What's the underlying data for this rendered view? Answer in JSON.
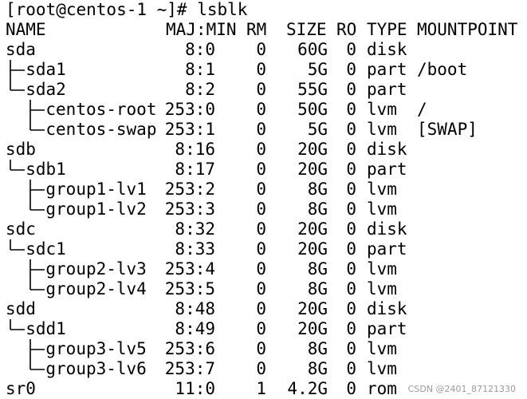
{
  "prompt": "[root@centos-1 ~]# lsblk",
  "headers": {
    "name": "NAME",
    "majmin": "MAJ:MIN",
    "rm": "RM",
    "size": "SIZE",
    "ro": "RO",
    "type": "TYPE",
    "mountpoint": "MOUNTPOINT"
  },
  "rows": [
    {
      "name": "sda",
      "depth": 0,
      "tree": "",
      "majmin": "8:0",
      "rm": "0",
      "size": "60G",
      "ro": "0",
      "type": "disk",
      "mount": ""
    },
    {
      "name": "sda1",
      "depth": 1,
      "tree": "mid",
      "majmin": "8:1",
      "rm": "0",
      "size": "5G",
      "ro": "0",
      "type": "part",
      "mount": "/boot"
    },
    {
      "name": "sda2",
      "depth": 1,
      "tree": "last",
      "majmin": "8:2",
      "rm": "0",
      "size": "55G",
      "ro": "0",
      "type": "part",
      "mount": ""
    },
    {
      "name": "centos-root",
      "depth": 2,
      "tree": "mid",
      "majmin": "253:0",
      "rm": "0",
      "size": "50G",
      "ro": "0",
      "type": "lvm",
      "mount": "/"
    },
    {
      "name": "centos-swap",
      "depth": 2,
      "tree": "last",
      "majmin": "253:1",
      "rm": "0",
      "size": "5G",
      "ro": "0",
      "type": "lvm",
      "mount": "[SWAP]"
    },
    {
      "name": "sdb",
      "depth": 0,
      "tree": "",
      "majmin": "8:16",
      "rm": "0",
      "size": "20G",
      "ro": "0",
      "type": "disk",
      "mount": ""
    },
    {
      "name": "sdb1",
      "depth": 1,
      "tree": "last",
      "majmin": "8:17",
      "rm": "0",
      "size": "20G",
      "ro": "0",
      "type": "part",
      "mount": ""
    },
    {
      "name": "group1-lv1",
      "depth": 2,
      "tree": "mid",
      "majmin": "253:2",
      "rm": "0",
      "size": "8G",
      "ro": "0",
      "type": "lvm",
      "mount": ""
    },
    {
      "name": "group1-lv2",
      "depth": 2,
      "tree": "last",
      "majmin": "253:3",
      "rm": "0",
      "size": "8G",
      "ro": "0",
      "type": "lvm",
      "mount": ""
    },
    {
      "name": "sdc",
      "depth": 0,
      "tree": "",
      "majmin": "8:32",
      "rm": "0",
      "size": "20G",
      "ro": "0",
      "type": "disk",
      "mount": ""
    },
    {
      "name": "sdc1",
      "depth": 1,
      "tree": "last",
      "majmin": "8:33",
      "rm": "0",
      "size": "20G",
      "ro": "0",
      "type": "part",
      "mount": ""
    },
    {
      "name": "group2-lv3",
      "depth": 2,
      "tree": "mid",
      "majmin": "253:4",
      "rm": "0",
      "size": "8G",
      "ro": "0",
      "type": "lvm",
      "mount": ""
    },
    {
      "name": "group2-lv4",
      "depth": 2,
      "tree": "last",
      "majmin": "253:5",
      "rm": "0",
      "size": "8G",
      "ro": "0",
      "type": "lvm",
      "mount": ""
    },
    {
      "name": "sdd",
      "depth": 0,
      "tree": "",
      "majmin": "8:48",
      "rm": "0",
      "size": "20G",
      "ro": "0",
      "type": "disk",
      "mount": ""
    },
    {
      "name": "sdd1",
      "depth": 1,
      "tree": "last",
      "majmin": "8:49",
      "rm": "0",
      "size": "20G",
      "ro": "0",
      "type": "part",
      "mount": ""
    },
    {
      "name": "group3-lv5",
      "depth": 2,
      "tree": "mid",
      "majmin": "253:6",
      "rm": "0",
      "size": "8G",
      "ro": "0",
      "type": "lvm",
      "mount": ""
    },
    {
      "name": "group3-lv6",
      "depth": 2,
      "tree": "last",
      "majmin": "253:7",
      "rm": "0",
      "size": "8G",
      "ro": "0",
      "type": "lvm",
      "mount": ""
    },
    {
      "name": "sr0",
      "depth": 0,
      "tree": "",
      "majmin": "11:0",
      "rm": "1",
      "size": "4.2G",
      "ro": "0",
      "type": "rom",
      "mount": ""
    }
  ],
  "watermark": "CSDN @2401_87121330"
}
